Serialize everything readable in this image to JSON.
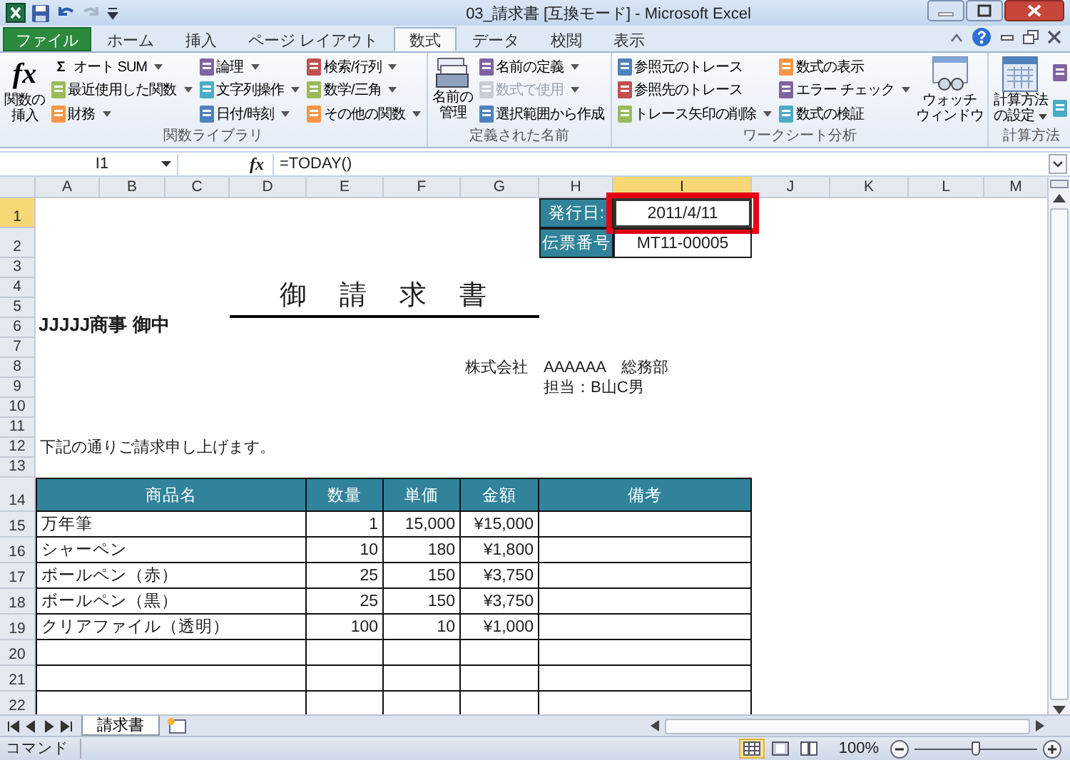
{
  "window": {
    "title": "03_請求書  [互換モード]  -  Microsoft Excel"
  },
  "ribbon_tabs": [
    {
      "label": "ファイル",
      "kind": "file",
      "selected": false
    },
    {
      "label": "ホーム",
      "kind": "tab",
      "selected": false
    },
    {
      "label": "挿入",
      "kind": "tab",
      "selected": false
    },
    {
      "label": "ページ レイアウト",
      "kind": "tab",
      "selected": false
    },
    {
      "label": "数式",
      "kind": "tab",
      "selected": true
    },
    {
      "label": "データ",
      "kind": "tab",
      "selected": false
    },
    {
      "label": "校閲",
      "kind": "tab",
      "selected": false
    },
    {
      "label": "表示",
      "kind": "tab",
      "selected": false
    }
  ],
  "ribbon_groups": [
    {
      "label": "関数ライブラリ",
      "items": [
        {
          "kind": "large",
          "lines": [
            "関数の",
            "挿入"
          ],
          "icon_text": "fx",
          "dropdown": false
        },
        {
          "kind": "small",
          "label": "オート SUM",
          "icon_text": "Σ",
          "dropdown": true
        },
        {
          "kind": "small",
          "label": "最近使用した関数",
          "dropdown": true
        },
        {
          "kind": "small",
          "label": "財務",
          "dropdown": true
        },
        {
          "kind": "small",
          "label": "論理",
          "dropdown": true
        },
        {
          "kind": "small",
          "label": "文字列操作",
          "dropdown": true
        },
        {
          "kind": "small",
          "label": "日付/時刻",
          "dropdown": true
        },
        {
          "kind": "small",
          "label": "検索/行列",
          "dropdown": true
        },
        {
          "kind": "small",
          "label": "数学/三角",
          "dropdown": true
        },
        {
          "kind": "small",
          "label": "その他の関数",
          "dropdown": true
        }
      ]
    },
    {
      "label": "定義された名前",
      "items": [
        {
          "kind": "large",
          "lines": [
            "名前の",
            "管理"
          ],
          "dropdown": false,
          "disabled": false
        },
        {
          "kind": "small",
          "label": "名前の定義",
          "dropdown": true,
          "disabled": false
        },
        {
          "kind": "small",
          "label": "数式で使用",
          "dropdown": true,
          "disabled": true
        },
        {
          "kind": "small",
          "label": "選択範囲から作成",
          "dropdown": false,
          "disabled": false
        }
      ]
    },
    {
      "label": "ワークシート分析",
      "items": [
        {
          "kind": "small",
          "label": "参照元のトレース",
          "dropdown": false
        },
        {
          "kind": "small",
          "label": "参照先のトレース",
          "dropdown": false
        },
        {
          "kind": "small",
          "label": "トレース矢印の削除",
          "dropdown": true
        },
        {
          "kind": "small",
          "label": "数式の表示",
          "dropdown": false
        },
        {
          "kind": "small",
          "label": "エラー チェック",
          "dropdown": true
        },
        {
          "kind": "small",
          "label": "数式の検証",
          "dropdown": false
        },
        {
          "kind": "large",
          "lines": [
            "ウォッチ",
            "ウィンドウ"
          ],
          "dropdown": false
        }
      ]
    },
    {
      "label": "計算方法",
      "items": [
        {
          "kind": "large",
          "lines": [
            "計算方法",
            "の設定"
          ],
          "dropdown": true
        },
        {
          "kind": "small",
          "dropdown": false
        },
        {
          "kind": "small",
          "dropdown": false
        }
      ]
    }
  ],
  "formula_bar": {
    "name_box": "I1",
    "function_label": "fx",
    "formula": "=TODAY()"
  },
  "sheet": {
    "columns": [
      {
        "label": "A",
        "selected": false
      },
      {
        "label": "B",
        "selected": false
      },
      {
        "label": "C",
        "selected": false
      },
      {
        "label": "D",
        "selected": false
      },
      {
        "label": "E",
        "selected": false
      },
      {
        "label": "F",
        "selected": false
      },
      {
        "label": "G",
        "selected": false
      },
      {
        "label": "H",
        "selected": false
      },
      {
        "label": "I",
        "selected": true
      },
      {
        "label": "J",
        "selected": false
      },
      {
        "label": "K",
        "selected": false
      },
      {
        "label": "L",
        "selected": false
      },
      {
        "label": "M",
        "selected": false
      }
    ],
    "rows": [
      {
        "label": "1",
        "selected": true
      },
      {
        "label": "2",
        "selected": false
      },
      {
        "label": "3",
        "selected": false
      },
      {
        "label": "4",
        "selected": false
      },
      {
        "label": "5",
        "selected": false
      },
      {
        "label": "6",
        "selected": false
      },
      {
        "label": "7",
        "selected": false
      },
      {
        "label": "8",
        "selected": false
      },
      {
        "label": "9",
        "selected": false
      },
      {
        "label": "10",
        "selected": false
      },
      {
        "label": "11",
        "selected": false
      },
      {
        "label": "12",
        "selected": false
      },
      {
        "label": "13",
        "selected": false
      },
      {
        "label": "14",
        "selected": false
      },
      {
        "label": "15",
        "selected": false
      },
      {
        "label": "16",
        "selected": false
      },
      {
        "label": "17",
        "selected": false
      },
      {
        "label": "18",
        "selected": false
      },
      {
        "label": "19",
        "selected": false
      },
      {
        "label": "20",
        "selected": false
      },
      {
        "label": "21",
        "selected": false
      },
      {
        "label": "22",
        "selected": false
      }
    ],
    "issue_date": {
      "label": "発行日:",
      "value": "2011/4/11",
      "highlighted": true
    },
    "slip_number": {
      "label": "伝票番号",
      "value": "MT11-00005"
    },
    "title": "御　請　求　書",
    "recipient": "JJJJJ商事 御中",
    "issuer": "株式会社　AAAAAA　総務部",
    "contact": "担当：B山C男",
    "message": "下記の通りご請求申し上げます。",
    "table": {
      "columns": [
        "商品名",
        "数量",
        "単価",
        "金額",
        "備考"
      ],
      "rows": [
        [
          "万年筆",
          "1",
          "15,000",
          "¥15,000"
        ],
        [
          "シャーペン",
          "10",
          "180",
          "¥1,800"
        ],
        [
          "ボールペン（赤）",
          "25",
          "150",
          "¥3,750"
        ],
        [
          "ボールペン（黒）",
          "25",
          "150",
          "¥3,750"
        ],
        [
          "クリアファイル（透明）",
          "100",
          "10",
          "¥1,000"
        ]
      ]
    }
  },
  "sheet_tabs": [
    {
      "label": "請求書",
      "selected": true
    }
  ],
  "status_bar": {
    "mode": "コマンド",
    "views": [
      {
        "selected": true
      },
      {
        "selected": false
      },
      {
        "selected": false
      }
    ],
    "zoom": "100%",
    "zoom_level": {
      "level": 0.5
    }
  }
}
